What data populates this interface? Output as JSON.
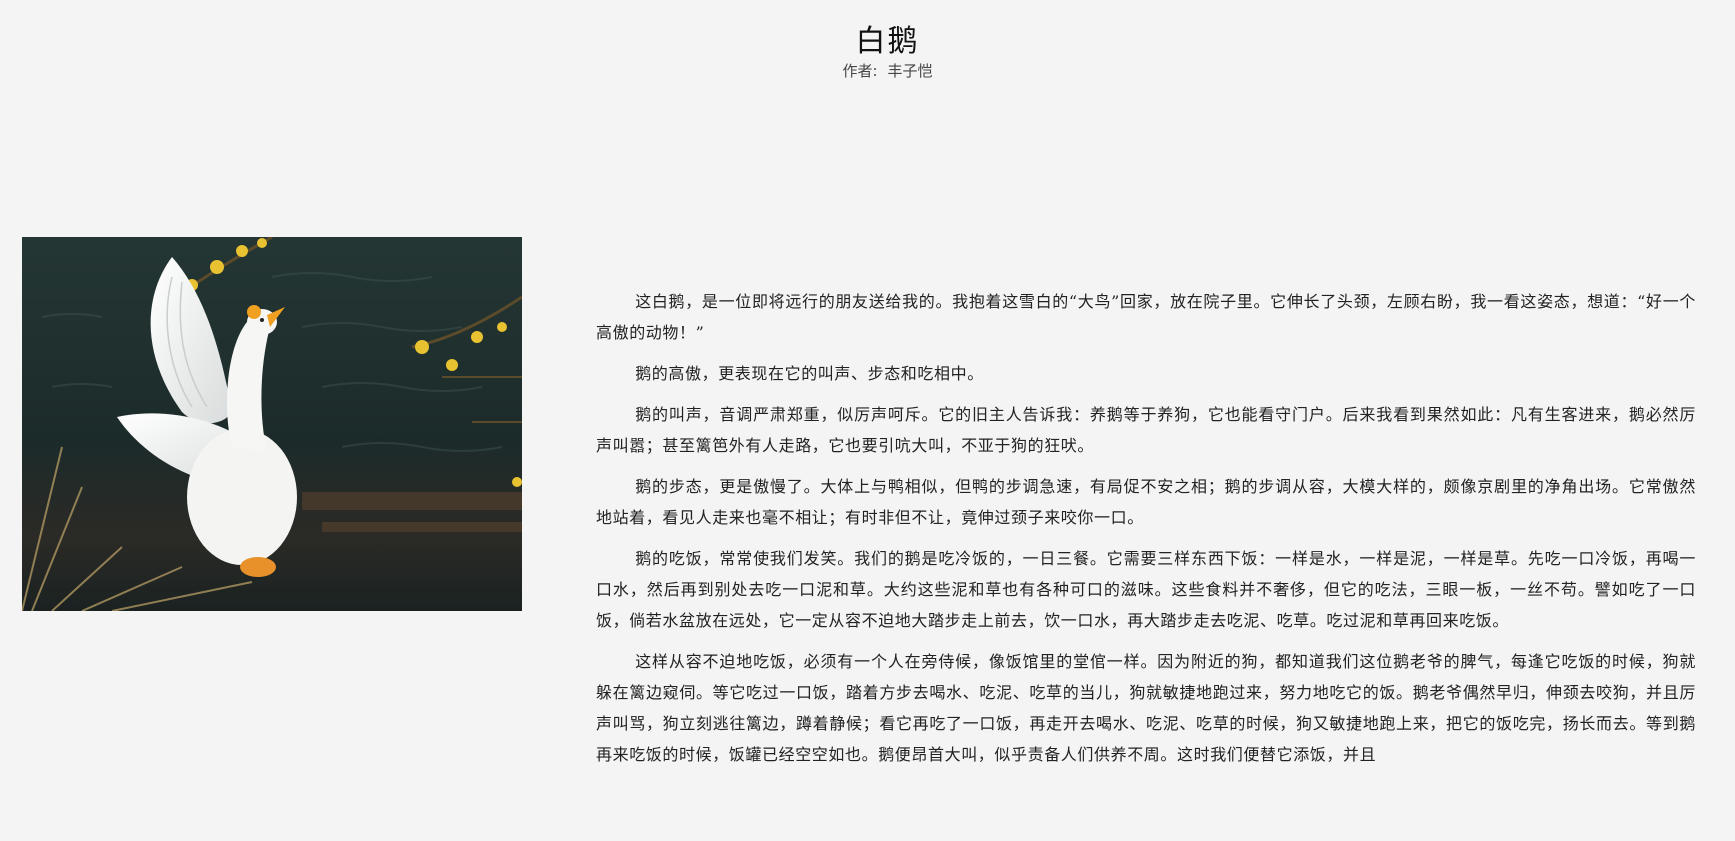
{
  "article": {
    "title": "白鹅",
    "author_label": "作者:",
    "author": "丰子恺",
    "paragraphs": [
      "这白鹅，是一位即将远行的朋友送给我的。我抱着这雪白的“大鸟”回家，放在院子里。它伸长了头颈，左顾右盼，我一看这姿态，想道：“好一个高傲的动物！”",
      "鹅的高傲，更表现在它的叫声、步态和吃相中。",
      "鹅的叫声，音调严肃郑重，似厉声呵斥。它的旧主人告诉我：养鹅等于养狗，它也能看守门户。后来我看到果然如此：凡有生客进来，鹅必然厉声叫嚣；甚至篱笆外有人走路，它也要引吭大叫，不亚于狗的狂吠。",
      "鹅的步态，更是傲慢了。大体上与鸭相似，但鸭的步调急速，有局促不安之相；鹅的步调从容，大模大样的，颇像京剧里的净角出场。它常傲然地站着，看见人走来也毫不相让；有时非但不让，竟伸过颈子来咬你一口。",
      "鹅的吃饭，常常使我们发笑。我们的鹅是吃冷饭的，一日三餐。它需要三样东西下饭：一样是水，一样是泥，一样是草。先吃一口冷饭，再喝一口水，然后再到别处去吃一口泥和草。大约这些泥和草也有各种可口的滋味。这些食料并不奢侈，但它的吃法，三眼一板，一丝不苟。譬如吃了一口饭，倘若水盆放在远处，它一定从容不迫地大踏步走上前去，饮一口水，再大踏步走去吃泥、吃草。吃过泥和草再回来吃饭。",
      "这样从容不迫地吃饭，必须有一个人在旁侍候，像饭馆里的堂倌一样。因为附近的狗，都知道我们这位鹅老爷的脾气，每逢它吃饭的时候，狗就躲在篱边窥伺。等它吃过一口饭，踏着方步去喝水、吃泥、吃草的当儿，狗就敏捷地跑过来，努力地吃它的饭。鹅老爷偶然早归，伸颈去咬狗，并且厉声叫骂，狗立刻逃往篱边，蹲着静候；看它再吃了一口饭，再走开去喝水、吃泥、吃草的时候，狗又敏捷地跑上来，把它的饭吃完，扬长而去。等到鹅再来吃饭的时候，饭罐已经空空如也。鹅便昂首大叫，似乎责备人们供养不周。这时我们便替它添饭，并且"
    ]
  },
  "image": {
    "subject": "white-goose-spreading-wings-by-water",
    "colors": {
      "water": "#1f302f",
      "goose": "#f6f6f4",
      "beak": "#f0a020",
      "blossom": "#e8c230"
    }
  }
}
